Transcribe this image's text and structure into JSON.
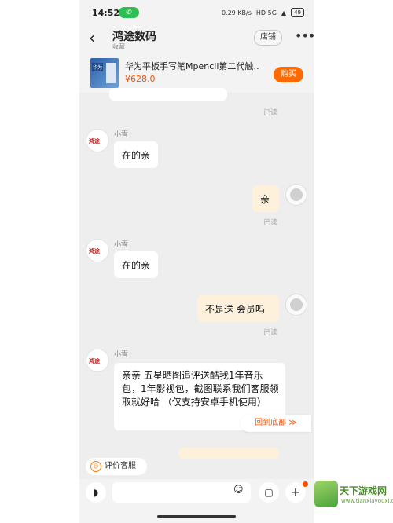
{
  "status": {
    "time": "14:52",
    "call_badge": "1",
    "speed": "0.29 KB/s",
    "network": "HD 5G",
    "battery": "49"
  },
  "header": {
    "shop_name": "鸿途数码",
    "favorite_label": "收藏",
    "store_button": "店铺",
    "more_label": "•••"
  },
  "product": {
    "title": "华为平板手写笔Mpencil第二代触…",
    "price": "¥628.0",
    "buy_button": "购买",
    "thumb_tag": "华为"
  },
  "messages": [
    {
      "from": "agent",
      "name": "小雪",
      "text": "在的亲"
    },
    {
      "from": "user",
      "text": "亲",
      "status": "已读"
    },
    {
      "from": "agent",
      "name": "小雪",
      "text": "在的亲"
    },
    {
      "from": "user",
      "text": "不是送 会员吗",
      "status": "已读"
    },
    {
      "from": "agent",
      "name": "小雪",
      "text": "亲亲 五星晒图追评送酷我1年音乐包，1年影视包，截图联系我们客服领取就好哈 （仅支持安卓手机使用）"
    }
  ],
  "top_read": "已读",
  "agent_logo": "鸿途",
  "jump_bottom": "回到底部 ≫",
  "rate_button": "评价客服",
  "watermark": {
    "title": "天下游戏网",
    "url": "www.tianxiayouxi.com"
  },
  "colors": {
    "accent": "#ff5000",
    "buy": "#ff6a00",
    "out_bubble": "#fdf1dc",
    "bg": "#eeeeee"
  }
}
